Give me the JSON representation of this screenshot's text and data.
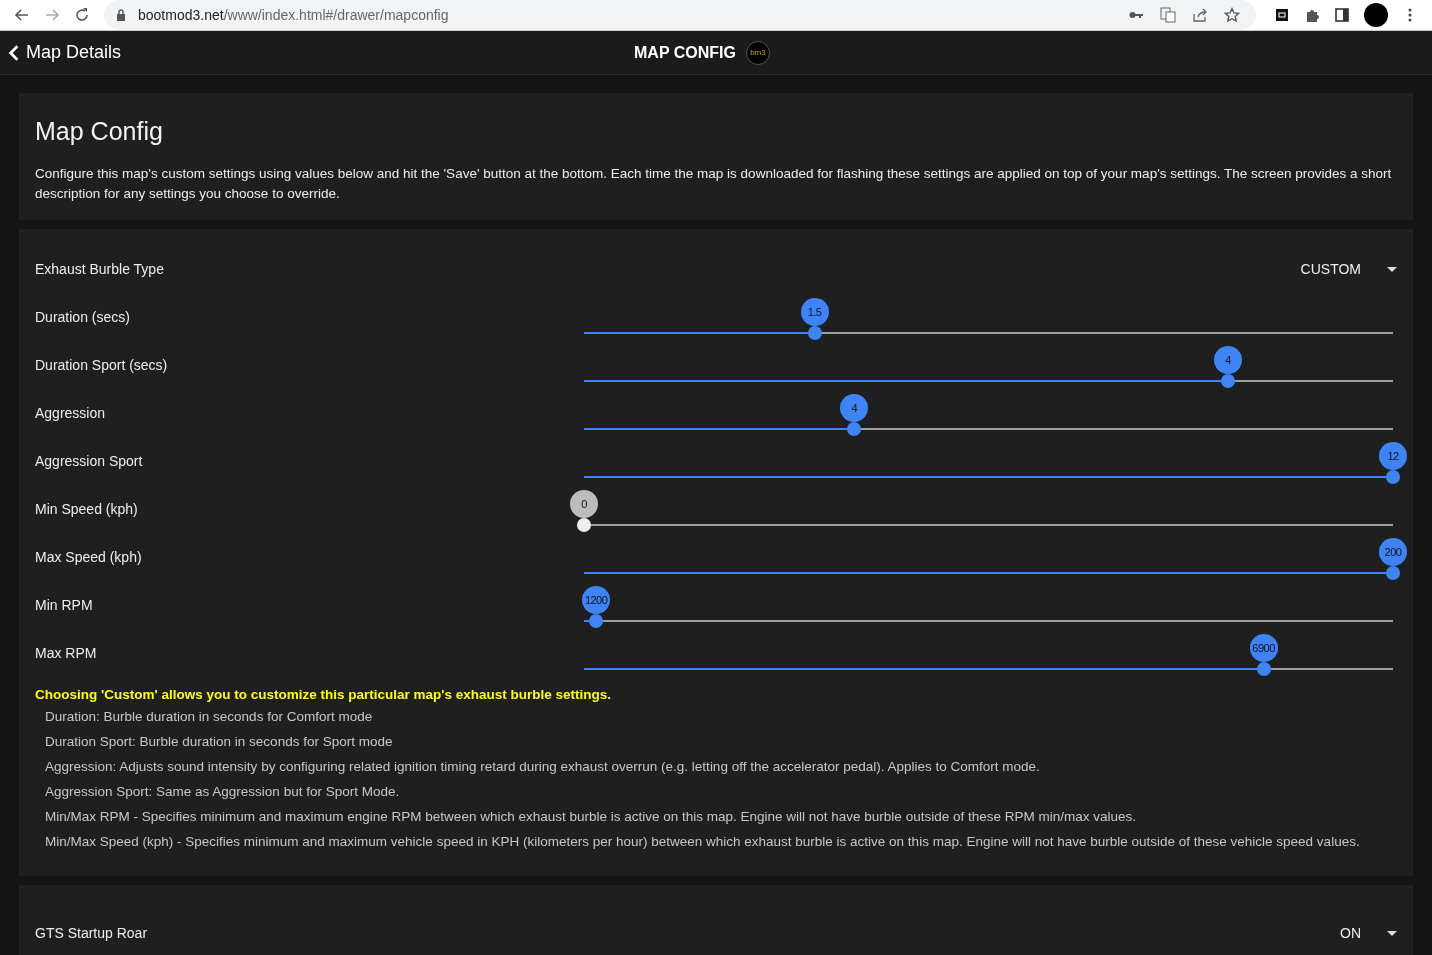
{
  "browser": {
    "url_host": "bootmod3.net",
    "url_path": "/www/index.html#/drawer/mapconfig"
  },
  "header": {
    "back_label": "Map Details",
    "title": "MAP CONFIG",
    "logo_text": "bm3"
  },
  "intro": {
    "title": "Map Config",
    "description": "Configure this map's custom settings using values below and hit the 'Save' button at the bottom. Each time the map is downloaded for flashing these settings are applied on top of your map's settings. The screen provides a short description for any settings you choose to override."
  },
  "burble": {
    "label": "Exhaust Burble Type",
    "value": "CUSTOM",
    "sliders": [
      {
        "label": "Duration (secs)",
        "value": "1.5",
        "level": 0.285
      },
      {
        "label": "Duration Sport (secs)",
        "value": "4",
        "level": 0.796
      },
      {
        "label": "Aggression",
        "value": "4",
        "level": 0.334
      },
      {
        "label": "Aggression Sport",
        "value": "12",
        "level": 1
      },
      {
        "label": "Min Speed (kph)",
        "value": "0",
        "level": 0
      },
      {
        "label": "Max Speed (kph)",
        "value": "200",
        "level": 1
      },
      {
        "label": "Min RPM",
        "value": "1200",
        "level": 0.015
      },
      {
        "label": "Max RPM",
        "value": "6900",
        "level": 0.84
      }
    ],
    "note": "Choosing 'Custom' allows you to customize this particular map's exhaust burble settings.",
    "help": [
      "Duration: Burble duration in seconds for Comfort mode",
      "Duration Sport: Burble duration in seconds for Sport mode",
      "Aggression: Adjusts sound intensity by configuring related ignition timing retard during exhaust overrun (e.g. letting off the accelerator pedal). Applies to Comfort mode.",
      "Aggression Sport: Same as Aggression but for Sport Mode.",
      "Min/Max RPM - Specifies minimum and maximum engine RPM between which exhaust burble is active on this map. Engine will not have burble outside of these RPM min/max values.",
      "Min/Max Speed (kph) - Specifies minimum and maximum vehicle speed in KPH (kilometers per hour) between which exhaust burble is active on this map. Engine will not have burble outside of these vehicle speed values."
    ]
  },
  "startup": {
    "label": "GTS Startup Roar",
    "value": "ON"
  }
}
